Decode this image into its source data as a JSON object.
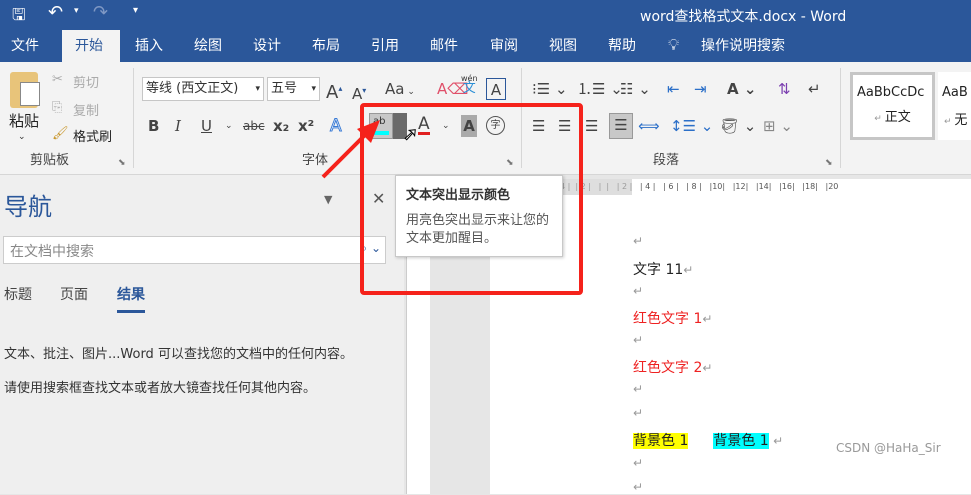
{
  "title": "word查找格式文本.docx  -  Word",
  "qat": {
    "save": "save-icon",
    "undo": "undo-icon",
    "redo": "redo-icon",
    "more": "▾"
  },
  "tabs": [
    "文件",
    "开始",
    "插入",
    "绘图",
    "设计",
    "布局",
    "引用",
    "邮件",
    "审阅",
    "视图",
    "帮助"
  ],
  "tell_me": "操作说明搜索",
  "clipboard": {
    "paste": "粘贴",
    "cut": "剪切",
    "copy": "复制",
    "format_painter": "格式刷",
    "group": "剪贴板"
  },
  "font": {
    "name": "等线 (西文正文)",
    "size": "五号",
    "group": "字体",
    "case": "Aa",
    "bold": "B",
    "italic": "I",
    "underline": "U",
    "strike": "abc",
    "sub": "x₂",
    "sup": "x²",
    "pinyin_top": "wén",
    "pinyin": "文",
    "border": "A",
    "highlight": "ab",
    "color": "A",
    "shade": "A",
    "enclose": "字"
  },
  "paragraph": {
    "group": "段落"
  },
  "styles": {
    "items": [
      {
        "preview": "AaBbCcDc",
        "name": "正文"
      },
      {
        "preview": "AaB",
        "name": "无"
      }
    ]
  },
  "tooltip": {
    "title": "文本突出显示颜色",
    "body": "用亮色突出显示来让您的文本更加醒目。"
  },
  "nav": {
    "title": "导航",
    "search_placeholder": "在文档中搜索",
    "tabs": [
      "标题",
      "页面",
      "结果"
    ],
    "active_tab": 2,
    "msg1": "文本、批注、图片...Word 可以查找您的文档中的任何内容。",
    "msg2": "请使用搜索框查找文本或者放大镜查找任何其他内容。"
  },
  "ruler": "4 |  | 2 |   |  |   | 2 |   | 4 |   | 6 |   | 8 |   |10|   |12|   |14|   |16|   |18|   |20",
  "doc": {
    "lines": [
      {
        "text": "",
        "color": "#222"
      },
      {
        "text": "文字 11",
        "color": "#222"
      },
      {
        "text": "",
        "color": "#222"
      },
      {
        "text": "红色文字 1",
        "color": "#ee2222"
      },
      {
        "text": "",
        "color": "#222"
      },
      {
        "text": "红色文字 2",
        "color": "#ee2222"
      },
      {
        "text": "",
        "color": "#222"
      },
      {
        "text": "",
        "color": "#222"
      }
    ],
    "bg1": "背景色 1",
    "bg2": "背景色 1",
    "bg1_color": "#ffff00",
    "bg2_color": "#00ffff"
  },
  "watermark": "CSDN @HaHa_Sir",
  "colors": {
    "brand": "#2b579a",
    "annotation": "#f5221b"
  }
}
